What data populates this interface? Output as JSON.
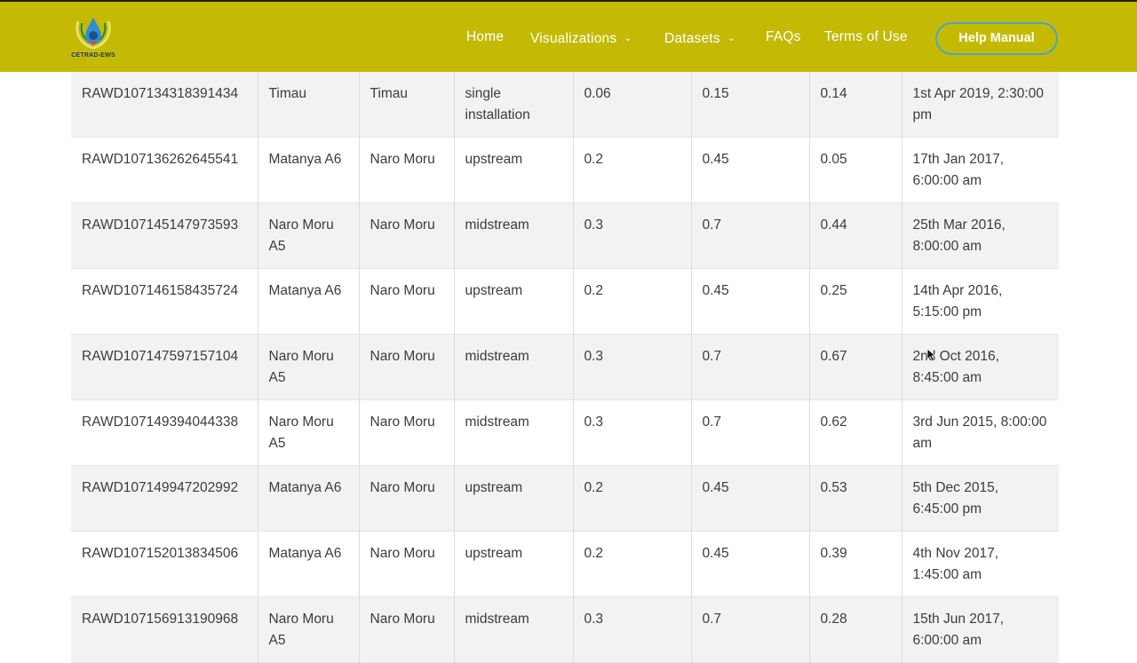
{
  "header": {
    "logo_text": "CETRAD-EWS",
    "nav": [
      {
        "label": "Home",
        "dropdown": false
      },
      {
        "label": "Visualizations",
        "dropdown": true
      },
      {
        "label": "Datasets",
        "dropdown": true
      },
      {
        "label": "FAQs",
        "dropdown": false
      },
      {
        "label": "Terms of Use",
        "dropdown": false
      }
    ],
    "help_button": "Help Manual",
    "colors": {
      "bar": "#c4ba04",
      "button_border": "#4aa6c6"
    }
  },
  "table": {
    "rows": [
      {
        "id": "RAWD107134318391434",
        "station": "Timau",
        "river": "Timau",
        "type": "single installation",
        "v1": "0.06",
        "v2": "0.15",
        "v3": "0.14",
        "date": "1st Apr 2019, 2:30:00 pm"
      },
      {
        "id": "RAWD107136262645541",
        "station": "Matanya A6",
        "river": "Naro Moru",
        "type": "upstream",
        "v1": "0.2",
        "v2": "0.45",
        "v3": "0.05",
        "date": "17th Jan 2017, 6:00:00 am"
      },
      {
        "id": "RAWD107145147973593",
        "station": "Naro Moru A5",
        "river": "Naro Moru",
        "type": "midstream",
        "v1": "0.3",
        "v2": "0.7",
        "v3": "0.44",
        "date": "25th Mar 2016, 8:00:00 am"
      },
      {
        "id": "RAWD107146158435724",
        "station": "Matanya A6",
        "river": "Naro Moru",
        "type": "upstream",
        "v1": "0.2",
        "v2": "0.45",
        "v3": "0.25",
        "date": "14th Apr 2016, 5:15:00 pm"
      },
      {
        "id": "RAWD107147597157104",
        "station": "Naro Moru A5",
        "river": "Naro Moru",
        "type": "midstream",
        "v1": "0.3",
        "v2": "0.7",
        "v3": "0.67",
        "date": "2nd Oct 2016, 8:45:00 am"
      },
      {
        "id": "RAWD107149394044338",
        "station": "Naro Moru A5",
        "river": "Naro Moru",
        "type": "midstream",
        "v1": "0.3",
        "v2": "0.7",
        "v3": "0.62",
        "date": "3rd Jun 2015, 8:00:00 am"
      },
      {
        "id": "RAWD107149947202992",
        "station": "Matanya A6",
        "river": "Naro Moru",
        "type": "upstream",
        "v1": "0.2",
        "v2": "0.45",
        "v3": "0.53",
        "date": "5th Dec 2015, 6:45:00 pm"
      },
      {
        "id": "RAWD107152013834506",
        "station": "Matanya A6",
        "river": "Naro Moru",
        "type": "upstream",
        "v1": "0.2",
        "v2": "0.45",
        "v3": "0.39",
        "date": "4th Nov 2017, 1:45:00 am"
      },
      {
        "id": "RAWD107156913190968",
        "station": "Naro Moru A5",
        "river": "Naro Moru",
        "type": "midstream",
        "v1": "0.3",
        "v2": "0.7",
        "v3": "0.28",
        "date": "15th Jun 2017, 6:00:00 am"
      }
    ]
  }
}
